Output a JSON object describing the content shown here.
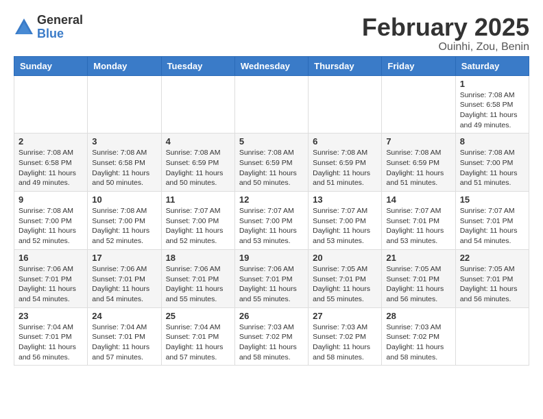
{
  "header": {
    "logo_general": "General",
    "logo_blue": "Blue",
    "month_title": "February 2025",
    "location": "Ouinhi, Zou, Benin"
  },
  "days_of_week": [
    "Sunday",
    "Monday",
    "Tuesday",
    "Wednesday",
    "Thursday",
    "Friday",
    "Saturday"
  ],
  "weeks": [
    [
      {
        "day": "",
        "info": ""
      },
      {
        "day": "",
        "info": ""
      },
      {
        "day": "",
        "info": ""
      },
      {
        "day": "",
        "info": ""
      },
      {
        "day": "",
        "info": ""
      },
      {
        "day": "",
        "info": ""
      },
      {
        "day": "1",
        "info": "Sunrise: 7:08 AM\nSunset: 6:58 PM\nDaylight: 11 hours\nand 49 minutes."
      }
    ],
    [
      {
        "day": "2",
        "info": "Sunrise: 7:08 AM\nSunset: 6:58 PM\nDaylight: 11 hours\nand 49 minutes."
      },
      {
        "day": "3",
        "info": "Sunrise: 7:08 AM\nSunset: 6:58 PM\nDaylight: 11 hours\nand 50 minutes."
      },
      {
        "day": "4",
        "info": "Sunrise: 7:08 AM\nSunset: 6:59 PM\nDaylight: 11 hours\nand 50 minutes."
      },
      {
        "day": "5",
        "info": "Sunrise: 7:08 AM\nSunset: 6:59 PM\nDaylight: 11 hours\nand 50 minutes."
      },
      {
        "day": "6",
        "info": "Sunrise: 7:08 AM\nSunset: 6:59 PM\nDaylight: 11 hours\nand 51 minutes."
      },
      {
        "day": "7",
        "info": "Sunrise: 7:08 AM\nSunset: 6:59 PM\nDaylight: 11 hours\nand 51 minutes."
      },
      {
        "day": "8",
        "info": "Sunrise: 7:08 AM\nSunset: 7:00 PM\nDaylight: 11 hours\nand 51 minutes."
      }
    ],
    [
      {
        "day": "9",
        "info": "Sunrise: 7:08 AM\nSunset: 7:00 PM\nDaylight: 11 hours\nand 52 minutes."
      },
      {
        "day": "10",
        "info": "Sunrise: 7:08 AM\nSunset: 7:00 PM\nDaylight: 11 hours\nand 52 minutes."
      },
      {
        "day": "11",
        "info": "Sunrise: 7:07 AM\nSunset: 7:00 PM\nDaylight: 11 hours\nand 52 minutes."
      },
      {
        "day": "12",
        "info": "Sunrise: 7:07 AM\nSunset: 7:00 PM\nDaylight: 11 hours\nand 53 minutes."
      },
      {
        "day": "13",
        "info": "Sunrise: 7:07 AM\nSunset: 7:00 PM\nDaylight: 11 hours\nand 53 minutes."
      },
      {
        "day": "14",
        "info": "Sunrise: 7:07 AM\nSunset: 7:01 PM\nDaylight: 11 hours\nand 53 minutes."
      },
      {
        "day": "15",
        "info": "Sunrise: 7:07 AM\nSunset: 7:01 PM\nDaylight: 11 hours\nand 54 minutes."
      }
    ],
    [
      {
        "day": "16",
        "info": "Sunrise: 7:06 AM\nSunset: 7:01 PM\nDaylight: 11 hours\nand 54 minutes."
      },
      {
        "day": "17",
        "info": "Sunrise: 7:06 AM\nSunset: 7:01 PM\nDaylight: 11 hours\nand 54 minutes."
      },
      {
        "day": "18",
        "info": "Sunrise: 7:06 AM\nSunset: 7:01 PM\nDaylight: 11 hours\nand 55 minutes."
      },
      {
        "day": "19",
        "info": "Sunrise: 7:06 AM\nSunset: 7:01 PM\nDaylight: 11 hours\nand 55 minutes."
      },
      {
        "day": "20",
        "info": "Sunrise: 7:05 AM\nSunset: 7:01 PM\nDaylight: 11 hours\nand 55 minutes."
      },
      {
        "day": "21",
        "info": "Sunrise: 7:05 AM\nSunset: 7:01 PM\nDaylight: 11 hours\nand 56 minutes."
      },
      {
        "day": "22",
        "info": "Sunrise: 7:05 AM\nSunset: 7:01 PM\nDaylight: 11 hours\nand 56 minutes."
      }
    ],
    [
      {
        "day": "23",
        "info": "Sunrise: 7:04 AM\nSunset: 7:01 PM\nDaylight: 11 hours\nand 56 minutes."
      },
      {
        "day": "24",
        "info": "Sunrise: 7:04 AM\nSunset: 7:01 PM\nDaylight: 11 hours\nand 57 minutes."
      },
      {
        "day": "25",
        "info": "Sunrise: 7:04 AM\nSunset: 7:01 PM\nDaylight: 11 hours\nand 57 minutes."
      },
      {
        "day": "26",
        "info": "Sunrise: 7:03 AM\nSunset: 7:02 PM\nDaylight: 11 hours\nand 58 minutes."
      },
      {
        "day": "27",
        "info": "Sunrise: 7:03 AM\nSunset: 7:02 PM\nDaylight: 11 hours\nand 58 minutes."
      },
      {
        "day": "28",
        "info": "Sunrise: 7:03 AM\nSunset: 7:02 PM\nDaylight: 11 hours\nand 58 minutes."
      },
      {
        "day": "",
        "info": ""
      }
    ]
  ]
}
